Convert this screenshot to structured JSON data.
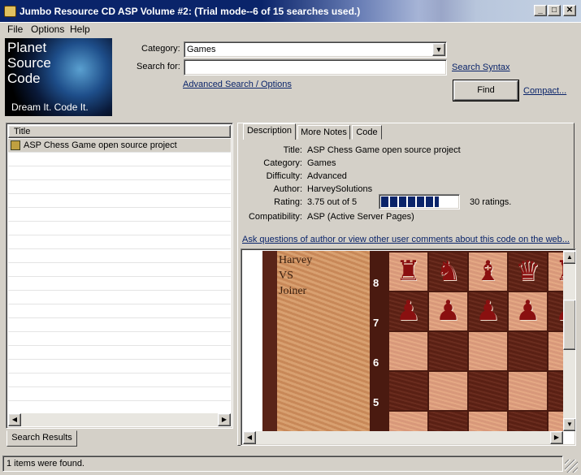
{
  "window": {
    "title": "Jumbo Resource CD ASP Volume #2: (Trial mode--6 of 15 searches used.)",
    "minimize": "_",
    "maximize": "□",
    "close": "✕"
  },
  "menu": [
    "File",
    "Options",
    "Help"
  ],
  "logo": {
    "line1": "Planet",
    "line2": "Source",
    "line3": "Code",
    "tagline": "Dream It.  Code It."
  },
  "search": {
    "category_label": "Category:",
    "category_value": "Games",
    "search_for_label": "Search for:",
    "search_for_value": "",
    "search_syntax_link": "Search Syntax",
    "advanced_link": "Advanced Search / Options",
    "find_button": "Find",
    "compact_link": "Compact..."
  },
  "results": {
    "column_title": "Title",
    "items": [
      "ASP Chess Game open source project"
    ],
    "tab_label": "Search Results"
  },
  "detail": {
    "tabs": [
      "Description",
      "More Notes",
      "Code"
    ],
    "active_tab": "Description",
    "fields": {
      "title_label": "Title:",
      "title_value": "ASP Chess Game open source project",
      "category_label": "Category:",
      "category_value": "Games",
      "difficulty_label": "Difficulty:",
      "difficulty_value": "Advanced",
      "author_label": "Author:",
      "author_value": "HarveySolutions",
      "rating_label": "Rating:",
      "rating_value": "3.75 out of 5",
      "rating_fraction": 0.75,
      "rating_count": "30 ratings.",
      "compat_label": "Compatibility:",
      "compat_value": "ASP (Active Server Pages)"
    },
    "ask_link": "Ask questions of author or view other user comments about this code on the web...",
    "preview": {
      "player1": "Harvey",
      "vs": "VS",
      "player2": "Joiner",
      "rank_labels": [
        "8",
        "7",
        "6",
        "5"
      ],
      "piece_names": [
        "rook",
        "knight",
        "bishop",
        "queen",
        "pawn"
      ]
    }
  },
  "status": {
    "text": "1 items were found."
  },
  "colors": {
    "titlebar": "#0a246a",
    "face": "#d4d0c8",
    "link": "#0a246a",
    "rating_fill": "#0a246a"
  }
}
